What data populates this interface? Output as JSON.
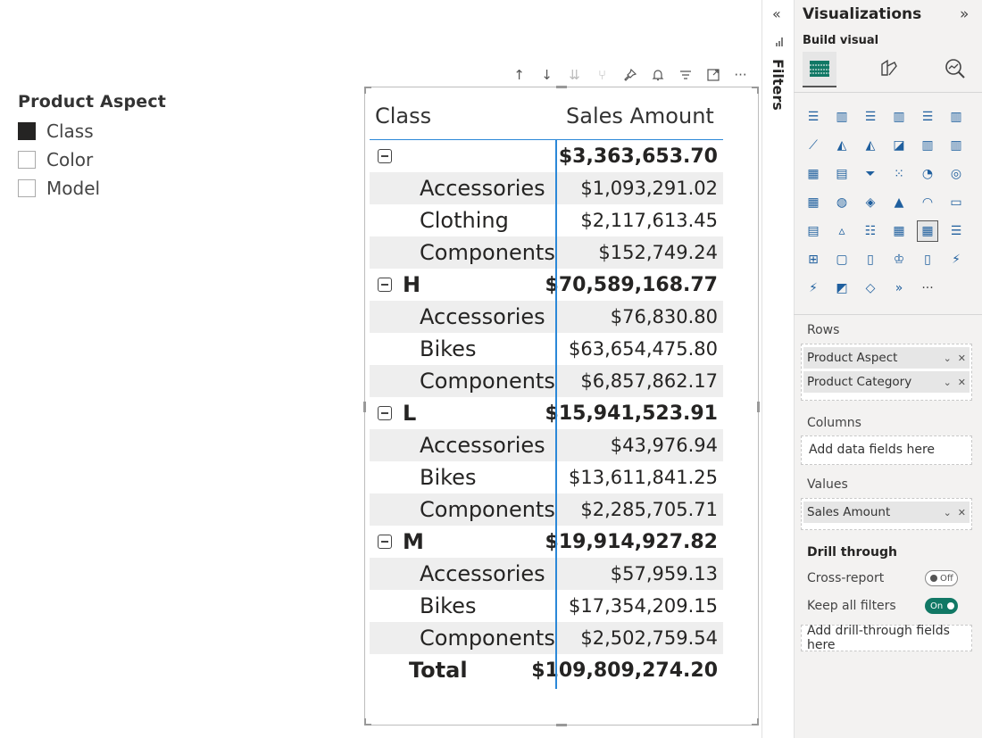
{
  "slicer": {
    "title": "Product Aspect",
    "options": [
      {
        "label": "Class",
        "checked": true
      },
      {
        "label": "Color",
        "checked": false
      },
      {
        "label": "Model",
        "checked": false
      }
    ]
  },
  "matrix": {
    "headers": [
      "Class",
      "Sales Amount"
    ],
    "groups": [
      {
        "label": "",
        "total": "$3,363,653.70",
        "rows": [
          {
            "label": "Accessories",
            "value": "$1,093,291.02"
          },
          {
            "label": "Clothing",
            "value": "$2,117,613.45"
          },
          {
            "label": "Components",
            "value": "$152,749.24"
          }
        ]
      },
      {
        "label": "H",
        "total": "$70,589,168.77",
        "rows": [
          {
            "label": "Accessories",
            "value": "$76,830.80"
          },
          {
            "label": "Bikes",
            "value": "$63,654,475.80"
          },
          {
            "label": "Components",
            "value": "$6,857,862.17"
          }
        ]
      },
      {
        "label": "L",
        "total": "$15,941,523.91",
        "rows": [
          {
            "label": "Accessories",
            "value": "$43,976.94"
          },
          {
            "label": "Bikes",
            "value": "$13,611,841.25"
          },
          {
            "label": "Components",
            "value": "$2,285,705.71"
          }
        ]
      },
      {
        "label": "M",
        "total": "$19,914,927.82",
        "rows": [
          {
            "label": "Accessories",
            "value": "$57,959.13"
          },
          {
            "label": "Bikes",
            "value": "$17,354,209.15"
          },
          {
            "label": "Components",
            "value": "$2,502,759.54"
          }
        ]
      }
    ],
    "total": {
      "label": "Total",
      "value": "$109,809,274.20"
    }
  },
  "filters": {
    "label": "Filters"
  },
  "pane": {
    "title": "Visualizations",
    "collapse_glyph": "»",
    "expand_glyph": "«",
    "build_label": "Build visual",
    "sections": {
      "rows": "Rows",
      "columns": "Columns",
      "values": "Values",
      "drill": "Drill through"
    },
    "rows_fields": [
      "Product Aspect",
      "Product Category"
    ],
    "columns_placeholder": "Add data fields here",
    "values_fields": [
      "Sales Amount"
    ],
    "cross_report": {
      "label": "Cross-report",
      "state": "Off"
    },
    "keep_filters": {
      "label": "Keep all filters",
      "state": "On"
    },
    "drill_placeholder": "Add drill-through fields here",
    "more_glyph": "···"
  },
  "icons": {
    "visual_types": [
      "stacked-bar",
      "stacked-column",
      "clustered-bar",
      "clustered-column",
      "100-bar",
      "100-column",
      "line",
      "area",
      "stacked-area",
      "ribbon",
      "line-column",
      "line-stacked-column",
      "waterfall",
      "funnel-like",
      "funnel",
      "scatter",
      "pie",
      "donut",
      "treemap",
      "map",
      "filled-map",
      "azure-map",
      "gauge",
      "card",
      "multi-card",
      "kpi",
      "slicer",
      "table",
      "matrix",
      "decomposition-list",
      "decomposition-tree",
      "qa",
      "narrative",
      "metrics",
      "paginated",
      "power-apps",
      "power-automate",
      "arcgis",
      "diamond-visual",
      "chevron-visual",
      "more"
    ]
  },
  "colors": {
    "accent_blue": "#2b88d8",
    "toggle_on": "#117865"
  }
}
